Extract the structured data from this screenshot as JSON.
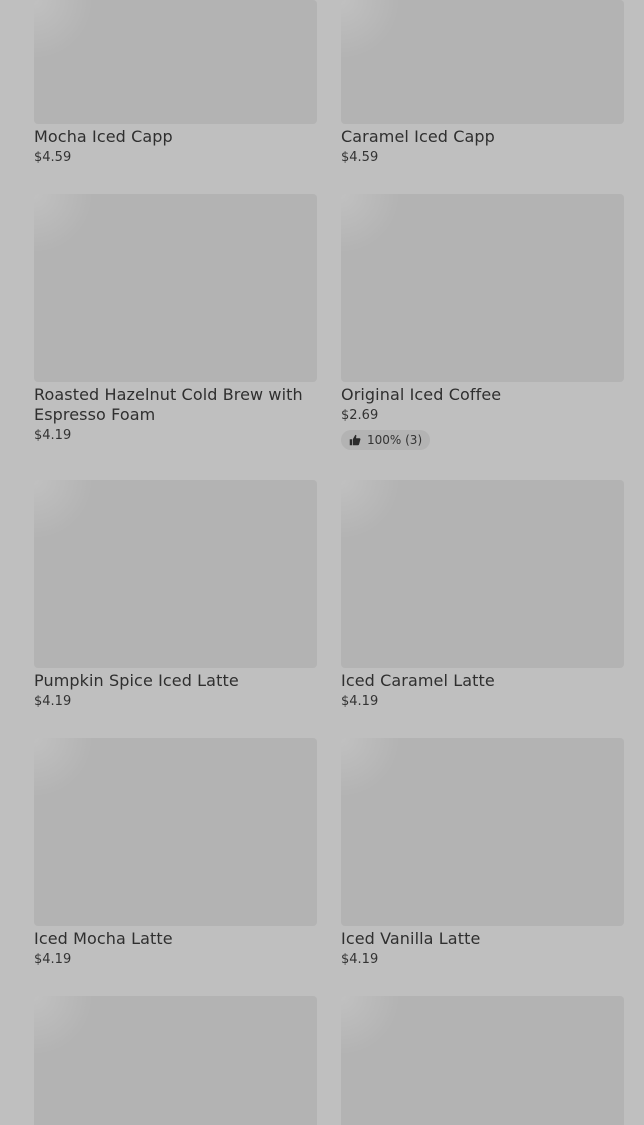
{
  "products": [
    {
      "name": "Mocha Iced Capp",
      "price": "$4.59"
    },
    {
      "name": "Caramel Iced Capp",
      "price": "$4.59"
    },
    {
      "name": "Roasted Hazelnut Cold Brew with Espresso Foam",
      "price": "$4.19"
    },
    {
      "name": "Original Iced Coffee",
      "price": "$2.69",
      "rating": "100% (3)",
      "rating_icon": "thumbs-up-icon"
    },
    {
      "name": "Pumpkin Spice Iced Latte",
      "price": "$4.19"
    },
    {
      "name": "Iced Caramel Latte",
      "price": "$4.19"
    },
    {
      "name": "Iced Mocha Latte",
      "price": "$4.19"
    },
    {
      "name": "Iced Vanilla Latte",
      "price": "$4.19"
    },
    {
      "name": "",
      "price": ""
    },
    {
      "name": "",
      "price": ""
    }
  ],
  "colors": {
    "background": "#bfbfbf",
    "image_placeholder": "#b3b3b3",
    "text": "#2f2f2f"
  }
}
